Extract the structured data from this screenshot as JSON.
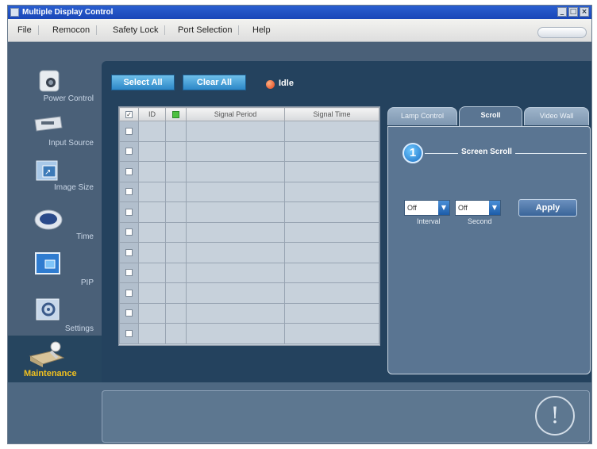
{
  "window": {
    "title": "Multiple Display Control",
    "title_buttons": [
      "_",
      "□",
      "×"
    ]
  },
  "menu": {
    "items": [
      "File",
      "Remocon",
      "Safety Lock",
      "Port Selection",
      "Help"
    ]
  },
  "sidebar": {
    "items": [
      {
        "label": "Power Control",
        "icon": "power-control-icon"
      },
      {
        "label": "Input Source",
        "icon": "input-source-icon"
      },
      {
        "label": "Image Size",
        "icon": "image-size-icon"
      },
      {
        "label": "Time",
        "icon": "time-icon"
      },
      {
        "label": "PIP",
        "icon": "pip-icon"
      },
      {
        "label": "Settings",
        "icon": "settings-icon"
      },
      {
        "label": "Maintenance",
        "icon": "maintenance-icon",
        "active": true
      }
    ]
  },
  "toolbar": {
    "select_all": "Select All",
    "clear_all": "Clear All",
    "status": "Idle"
  },
  "grid": {
    "columns": [
      "",
      "ID",
      "",
      "Signal Period",
      "Signal Time"
    ],
    "row_count": 11
  },
  "tabs": {
    "items": [
      "Lamp Control",
      "Scroll",
      "Video Wall"
    ],
    "active": "Scroll"
  },
  "scroll_panel": {
    "step_number": "1",
    "section_title": "Screen Scroll",
    "interval": {
      "value": "Off",
      "label": "Interval"
    },
    "second": {
      "value": "Off",
      "label": "Second"
    },
    "apply_label": "Apply"
  },
  "colors": {
    "accent": "#2c87c8",
    "active_label": "#f0c020",
    "background": "#4a6078"
  }
}
